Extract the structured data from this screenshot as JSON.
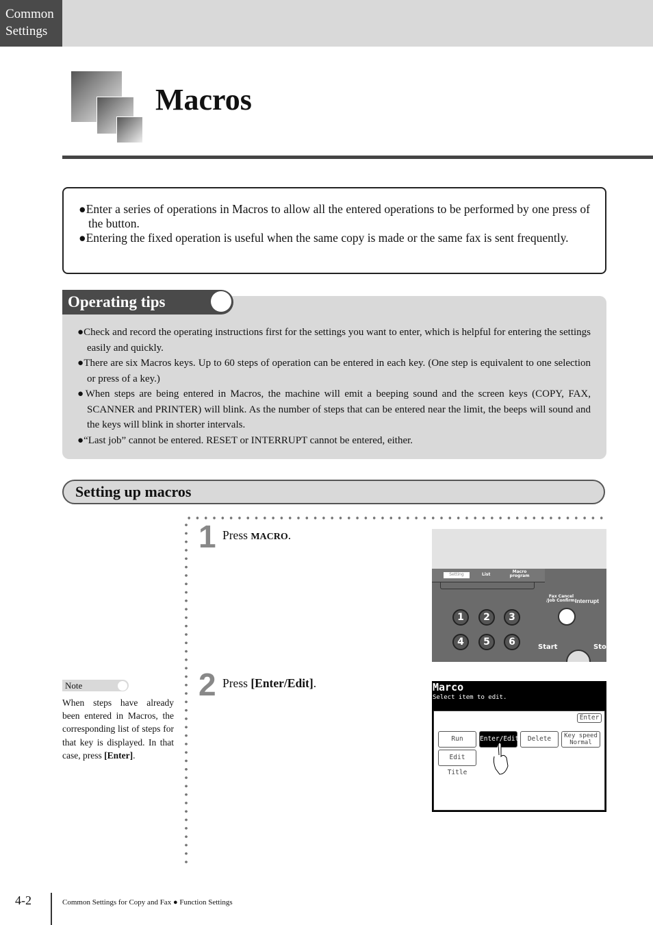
{
  "header": {
    "section_tab": "Common Settings"
  },
  "title": "Macros",
  "intro": [
    "Enter a series of operations in Macros to allow all the entered operations to be performed by one press of the button.",
    "Entering the fixed operation is useful when the same copy is made or the same fax is sent frequently."
  ],
  "tips": {
    "heading": "Operating tips",
    "items": [
      "Check and record the operating instructions first for the settings you want to enter, which is helpful for entering the settings easily and quickly.",
      "There are six Macros keys. Up to 60 steps of operation can be entered in each key. (One step is equivalent to one selection or press of a key.)",
      "When steps are being entered in Macros, the machine will emit a beeping sound and the screen keys (COPY, FAX, SCANNER and PRINTER) will blink. As the number of steps that can be entered near the limit, the beeps will sound and the keys will blink in shorter intervals.",
      "“Last job” cannot be entered. RESET or INTERRUPT cannot be entered, either."
    ]
  },
  "setup": {
    "heading": "Setting up macros",
    "steps": [
      {
        "num": "1",
        "pre": "Press ",
        "key": "MACRO",
        "post": "."
      },
      {
        "num": "2",
        "pre": "Press ",
        "key": "[Enter/Edit]",
        "post": "."
      }
    ]
  },
  "panel": {
    "tabs": [
      "Setting",
      "List",
      "Macro program"
    ],
    "fax_cancel": "Fax Cancel /Job Confirm.",
    "interrupt": "Interrupt",
    "keys": [
      "1",
      "2",
      "3",
      "4",
      "5",
      "6"
    ],
    "start": "Start",
    "stop": "Sto"
  },
  "lcd": {
    "title": "Marco",
    "subtitle": "Select item to edit.",
    "enter": "Enter",
    "buttons": [
      "Run",
      "Enter/Edit",
      "Delete",
      "Key speed Normal",
      "Edit Title"
    ]
  },
  "note": {
    "label": "Note",
    "text_pre": "When steps have already been entered in Macros, the corresponding list of steps for that key is displayed. In that case, press ",
    "key": "[Enter]",
    "text_post": "."
  },
  "footer": {
    "page": "4-2",
    "text": "Common Settings for Copy and Fax ● Function Settings"
  }
}
